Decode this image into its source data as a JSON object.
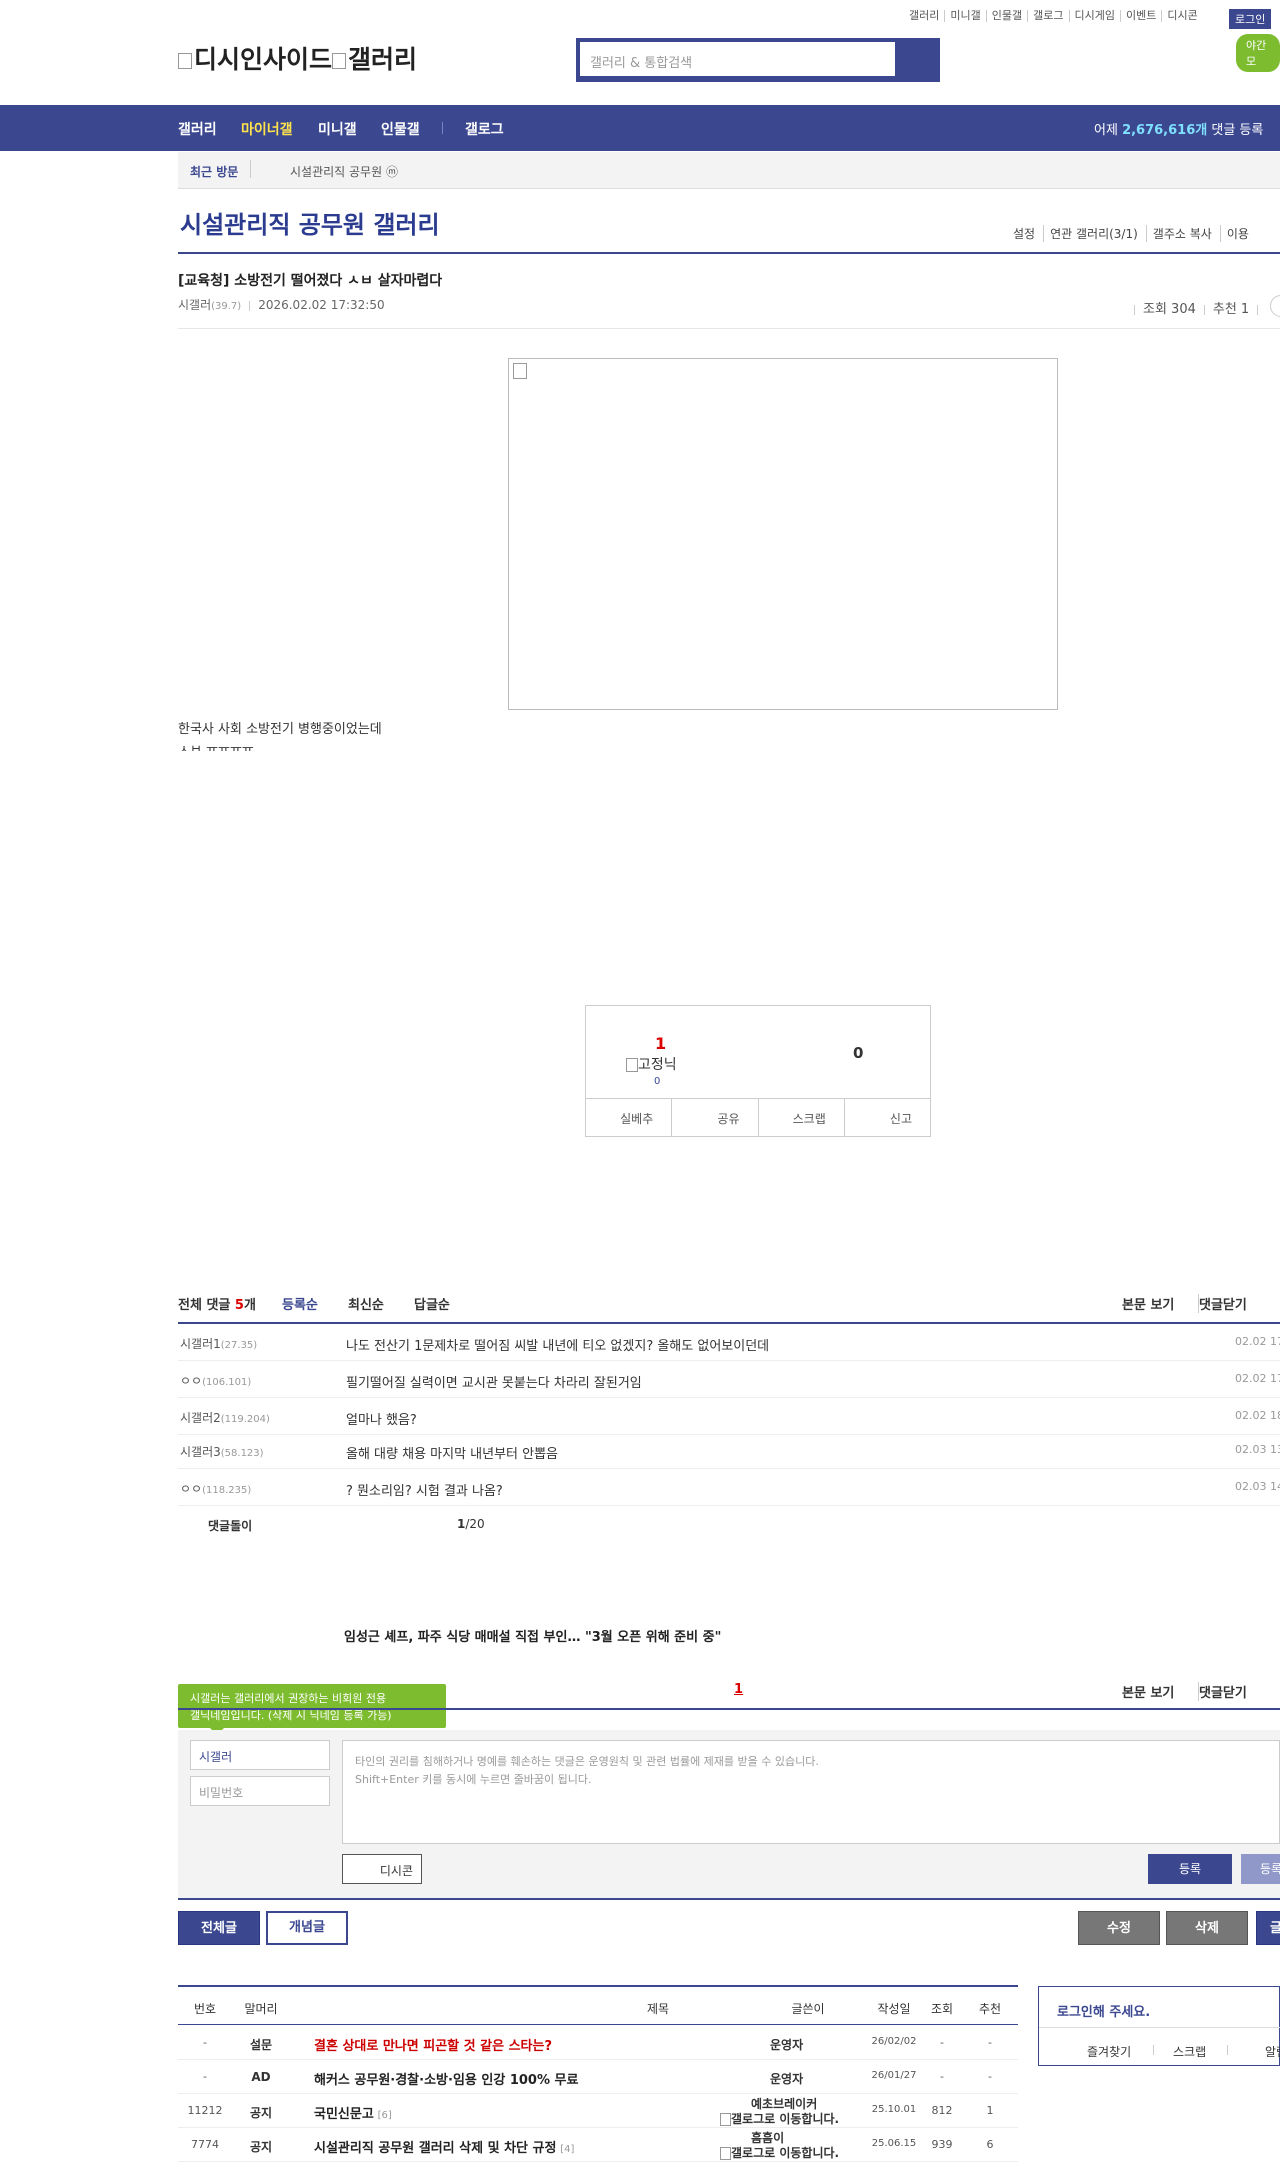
{
  "top_links": [
    "갤러리",
    "미니갤",
    "인물갤",
    "갤로그",
    "디시게임",
    "이벤트",
    "디시콘"
  ],
  "login_label": "로그인",
  "night_mode_label": "야간 모",
  "logo_alt": "디시인사이드",
  "logo_gallery_alt": "갤러리",
  "search": {
    "placeholder": "갤러리 & 통합검색"
  },
  "nav": {
    "items": [
      "갤러리",
      "마이너갤",
      "미니갤",
      "인물갤",
      "갤로그"
    ],
    "stats_prefix": "어제",
    "stats_value": "2,676,616개",
    "stats_suffix": "댓글 등록"
  },
  "recent": {
    "label": "최근 방문",
    "item": "시설관리직 공무원 ⓜ"
  },
  "gallery": {
    "title": "시설관리직 공무원 갤러리",
    "tools": [
      "설정",
      "연관 갤러리(3/1)",
      "갤주소 복사",
      "이용"
    ]
  },
  "post": {
    "title": "[교육청] 소방전기 떨어졌다 ㅅㅂ 살자마렵다",
    "writer": "시갤러",
    "writer_ip": "(39.7)",
    "date": "2026.02.02 17:32:50",
    "views": "조회 304",
    "recommends": "추천 1",
    "body_line1": "한국사 사회 소방전기 병행중이었는데",
    "body_line2": "ㅅㅂ ㅠㅠㅠㅠ"
  },
  "recommend": {
    "up": "1",
    "fixed_img_alt": "고정닉",
    "fixed_count": "0",
    "down": "0",
    "buttons": [
      "실베추",
      "공유",
      "스크랩",
      "신고"
    ]
  },
  "comments": {
    "header": "전체 댓글",
    "count": "5",
    "count_unit": "개",
    "tabs": [
      "등록순",
      "최신순",
      "답글순"
    ],
    "right": [
      "본문 보기",
      "댓글닫기"
    ],
    "rows": [
      {
        "nick": "시갤러1",
        "ip": "(27.35)",
        "text": "나도 전산기 1문제차로 떨어짐 씨발 내년에 티오 없겠지? 올해도 없어보이던데",
        "date": "02.02 17"
      },
      {
        "nick": "ㅇㅇ",
        "ip": "(106.101)",
        "text": "필기떨어질 실력이면 교시관 못붙는다 차라리 잘된거임",
        "date": "02.02 17"
      },
      {
        "nick": "시갤러2",
        "ip": "(119.204)",
        "text": "얼마나 했음?",
        "date": "02.02 18"
      },
      {
        "nick": "시갤러3",
        "ip": "(58.123)",
        "text": "올해 대량 채용 마지막 내년부터 안뽑음",
        "date": "02.03 13"
      },
      {
        "nick": "ㅇㅇ",
        "ip": "(118.235)",
        "text": "? 뭔소리임? 시험 결과 나옴?",
        "date": "02.03 14"
      }
    ],
    "bot_label": "댓글돌이",
    "page_current": "1",
    "page_total": "/20",
    "news": "임성근 셰프, 파주 식당 매매설 직접 부인… \"3월 오픈 위해 준비 중\"",
    "page2": "1",
    "tooltip_line1": "시갤러는 갤러리에서 권장하는 비회원 전용",
    "tooltip_line2": "갤닉네임입니다. (삭제 시 닉네임 등록 가능)"
  },
  "write": {
    "nick_value": "시갤러",
    "password_placeholder": "비밀번호",
    "textarea_line1": "타인의 권리를 침해하거나 명예를 훼손하는 댓글은 운영원칙 및 관련 법률에 제재를 받을 수 있습니다.",
    "textarea_line2": "Shift+Enter 키를 동시에 누르면 줄바꿈이 됩니다.",
    "dccon": "디시콘",
    "register": "등록",
    "register2": "등록"
  },
  "bottom_buttons": {
    "all": "전체글",
    "concept": "개념글",
    "edit": "수정",
    "delete": "삭제",
    "write": "글"
  },
  "list": {
    "headers": [
      "번호",
      "말머리",
      "제목",
      "글쓴이",
      "작성일",
      "조회",
      "추천"
    ],
    "rows": [
      {
        "num": "-",
        "head": "설문",
        "title": "결혼 상대로 만나면 피곤할 것 같은 스타는?",
        "red": true,
        "cnt": "",
        "writer": "운영자",
        "date": "26/02/02",
        "views": "-",
        "rec": "-"
      },
      {
        "num": "-",
        "head": "AD",
        "title": "해커스 공무원·경찰·소방·임용 인강 100% 무료",
        "red": false,
        "cnt": "",
        "writer": "운영자",
        "date": "26/01/27",
        "views": "-",
        "rec": "-"
      },
      {
        "num": "11212",
        "head": "공지",
        "title": "국민신문고",
        "red": false,
        "cnt": "[6]",
        "writer": "예초브레이커",
        "writer_sub": "갤로그로 이동합니다.",
        "date": "25.10.01",
        "views": "812",
        "rec": "1"
      },
      {
        "num": "7774",
        "head": "공지",
        "title": "시설관리직 공무원 갤러리 삭제 및 차단 규정",
        "red": false,
        "cnt": "[4]",
        "writer": "흠흠이",
        "writer_sub": "갤로그로 이동합니다.",
        "date": "25.06.15",
        "views": "939",
        "rec": "6"
      }
    ]
  },
  "login_box": {
    "title": "로그인해 주세요.",
    "links": [
      "즐겨찾기",
      "스크랩",
      "알림"
    ]
  }
}
